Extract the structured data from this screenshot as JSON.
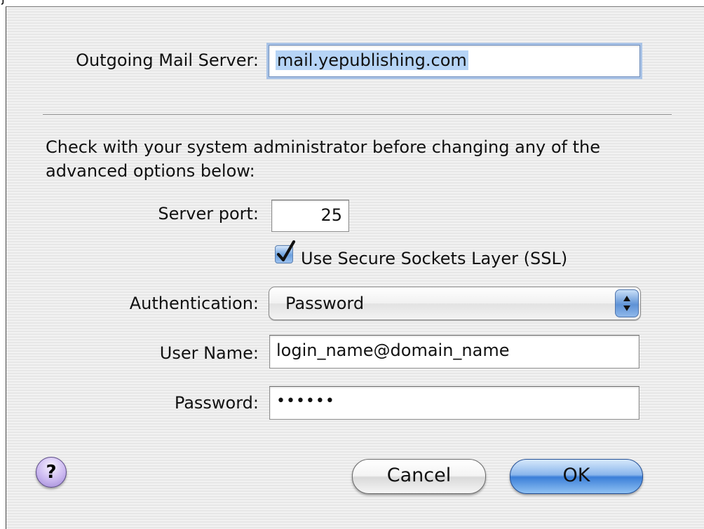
{
  "outgoing_server": {
    "label": "Outgoing Mail Server:",
    "value": "mail.yepublishing.com"
  },
  "info_text": "Check with your system administrator before changing any of the advanced options below:",
  "port": {
    "label": "Server port:",
    "value": "25"
  },
  "ssl": {
    "label": "Use Secure Sockets Layer (SSL)",
    "checked": true
  },
  "authentication": {
    "label": "Authentication:",
    "value": "Password"
  },
  "user_name": {
    "label": "User Name:",
    "value": "login_name@domain_name"
  },
  "password": {
    "label": "Password:",
    "value": "••••••"
  },
  "help": {
    "label": "?"
  },
  "buttons": {
    "cancel": "Cancel",
    "ok": "OK"
  },
  "colors": {
    "accent": "#3b7fd8",
    "selection": "#b6d4f6",
    "help": "#cbb8f0"
  }
}
